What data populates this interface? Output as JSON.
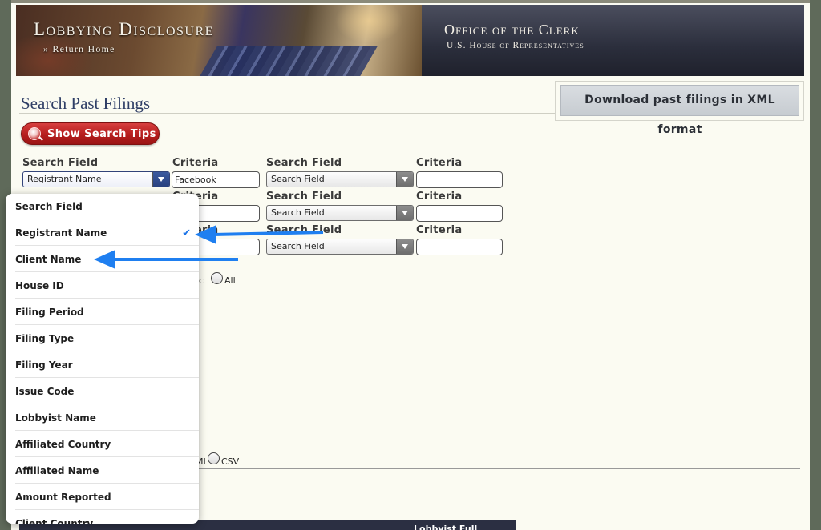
{
  "banner": {
    "title": "Lobbying Disclosure",
    "return_link": "» Return Home",
    "office_title": "Office of the Clerk",
    "office_subtitle": "U.S. House of Representatives"
  },
  "page": {
    "title": "Search Past Filings",
    "xml_download_label": "Download past filings in XML format",
    "tips_label": "Show Search Tips"
  },
  "form": {
    "search_field_label": "Search Field",
    "criteria_label": "Criteria",
    "row1": {
      "left_field": "Registrant Name",
      "left_criteria": "Facebook",
      "right_field": "Search Field",
      "right_criteria": ""
    },
    "row2": {
      "right_field": "Search Field",
      "right_criteria": ""
    },
    "row3": {
      "right_field": "Search Field",
      "right_criteria": ""
    },
    "partial_label_row2": "Search Field",
    "partial_criteria_row2": "Criteria",
    "partial_criteria_row3": "Criteria",
    "filing_option_partial": "nic",
    "filing_option_all": "All",
    "format_option_partial": "ML",
    "format_option_csv": "CSV",
    "results_column_partial": "Lobbyist Full"
  },
  "dropdown": {
    "selected": "Registrant Name",
    "options": [
      "Search Field",
      "Registrant Name",
      "Client Name",
      "House ID",
      "Filing Period",
      "Filing Type",
      "Filing Year",
      "Issue Code",
      "Lobbyist Name",
      "Affiliated Country",
      "Affiliated Name",
      "Amount Reported",
      "Client Country"
    ],
    "check_icon": "✔"
  },
  "colors": {
    "accent_blue": "#1a73e8",
    "title_navy": "#2f3e66",
    "tips_red": "#b51d1d",
    "annotation_arrow": "#1f7ff0"
  }
}
